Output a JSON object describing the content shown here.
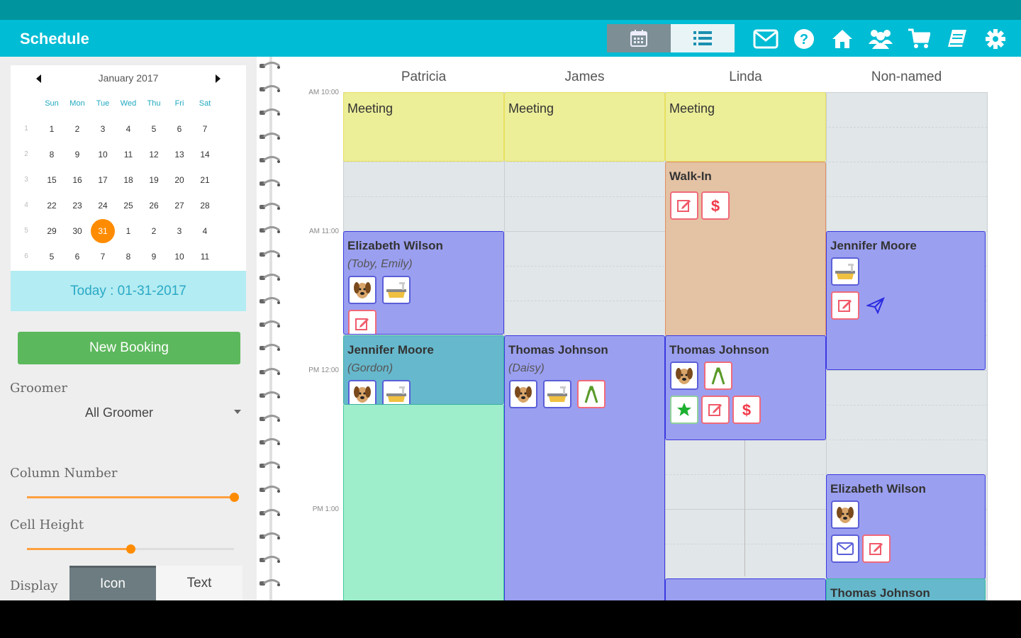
{
  "app": {
    "title": "Schedule"
  },
  "toolbar": {
    "colors": {
      "appbar": "#00bcd4",
      "statusbar": "#00949f"
    },
    "icons": [
      "mail-icon",
      "help-icon",
      "home-icon",
      "clients-icon",
      "cart-icon",
      "book-icon",
      "settings-icon"
    ]
  },
  "calendar": {
    "month_label": "January 2017",
    "dow": [
      "Sun",
      "Mon",
      "Tue",
      "Wed",
      "Thu",
      "Fri",
      "Sat"
    ],
    "weeks": [
      {
        "wk": "1",
        "days": [
          "1",
          "2",
          "3",
          "4",
          "5",
          "6",
          "7"
        ]
      },
      {
        "wk": "2",
        "days": [
          "8",
          "9",
          "10",
          "11",
          "12",
          "13",
          "14"
        ]
      },
      {
        "wk": "3",
        "days": [
          "15",
          "16",
          "17",
          "18",
          "19",
          "20",
          "21"
        ]
      },
      {
        "wk": "4",
        "days": [
          "22",
          "23",
          "24",
          "25",
          "26",
          "27",
          "28"
        ]
      },
      {
        "wk": "5",
        "days": [
          "29",
          "30",
          "31",
          "1",
          "2",
          "3",
          "4"
        ]
      },
      {
        "wk": "6",
        "days": [
          "5",
          "6",
          "7",
          "8",
          "9",
          "10",
          "11"
        ]
      }
    ],
    "selected_day": "31",
    "today_label": "Today : 01-31-2017"
  },
  "left": {
    "new_booking": "New Booking",
    "groomer_label": "Groomer",
    "groomer_value": "All Groomer",
    "column_number_label": "Column Number",
    "column_number_fraction": 1.0,
    "cell_height_label": "Cell Height",
    "cell_height_fraction": 0.5,
    "display_label": "Display",
    "display_options": [
      "Icon",
      "Text"
    ],
    "display_selected": "Icon"
  },
  "schedule": {
    "columns": [
      "Patricia",
      "James",
      "Linda",
      "Non-named"
    ],
    "times": [
      "AM 10:00",
      "AM 11:00",
      "PM 12:00",
      "PM 1:00"
    ],
    "colors": {
      "meeting": "#ecee98",
      "walkin": "#e4c2a4",
      "booking": "#9b9ff0",
      "teal": "#66b8cc",
      "green": "#9eeecc",
      "grid": "#e1e6e8"
    },
    "meetings": [
      {
        "label": "Meeting"
      },
      {
        "label": "Meeting"
      },
      {
        "label": "Meeting"
      }
    ],
    "walkin": {
      "label": "Walk-In"
    },
    "appointments": [
      {
        "name": "Elizabeth Wilson",
        "pets": "(Toby, Emily)"
      },
      {
        "name": "Jennifer Moore",
        "pets": "(Gordon)"
      },
      {
        "name": "Thomas Johnson",
        "pets": "(Daisy)"
      },
      {
        "name": "Thomas Johnson",
        "pets": ""
      },
      {
        "name": "Jennifer Moore",
        "pets": ""
      },
      {
        "name": "Elizabeth Wilson",
        "pets": ""
      },
      {
        "name": "Thomas Johnson",
        "pets": ""
      }
    ]
  }
}
